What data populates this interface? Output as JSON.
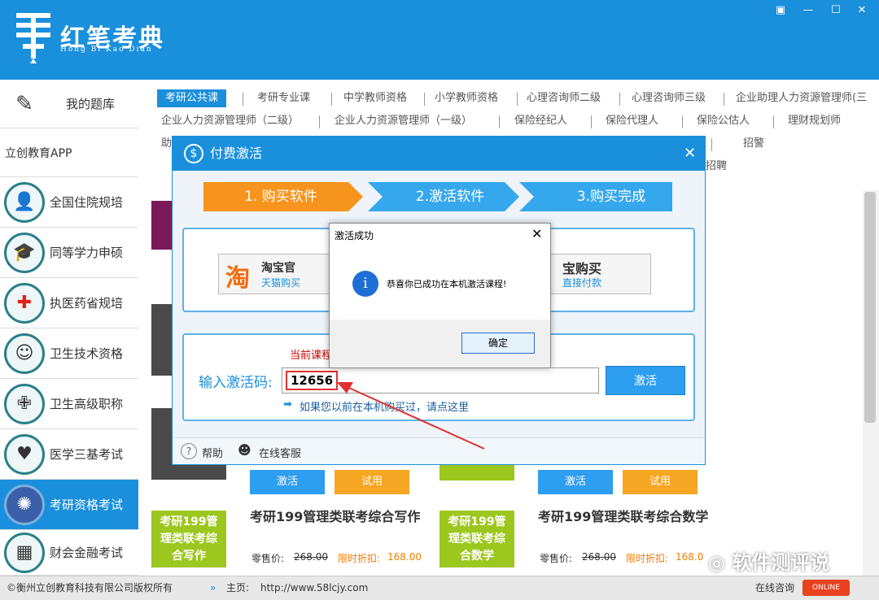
{
  "app": {
    "name_cn": "红笔考典",
    "name_en": "Hong Bi Kao Dian"
  },
  "window_controls": [
    "▣",
    "—",
    "☐",
    "✕"
  ],
  "sidebar": {
    "items": [
      {
        "label": "我的题库",
        "icon": "pen-book-icon"
      },
      {
        "label": "立创教育APP",
        "icon": ""
      },
      {
        "label": "全国住院规培",
        "icon": "doctor-icon"
      },
      {
        "label": "同等学力申硕",
        "icon": "graduation-cap-icon"
      },
      {
        "label": "执医药省规培",
        "icon": "red-cross-icon"
      },
      {
        "label": "卫生技术资格",
        "icon": "nurse-icon"
      },
      {
        "label": "卫生高级职称",
        "icon": "medical-kit-icon"
      },
      {
        "label": "医学三基考试",
        "icon": "medical-bag-icon"
      },
      {
        "label": "考研资格考试",
        "icon": "network-icon"
      },
      {
        "label": "财会金融考试",
        "icon": "calculator-icon"
      }
    ]
  },
  "tabs": {
    "row1": [
      "考研公共课",
      "考研专业课",
      "中学教师资格",
      "小学教师资格",
      "心理咨询师二级",
      "心理咨询师三级",
      "企业助理人力资源管理师(三"
    ],
    "row2": [
      "企业人力资源管理师（二级）",
      "企业人力资源管理师（一级）",
      "保险经纪人",
      "保险代理人",
      "保险公估人",
      "理财规划师"
    ],
    "row3": [
      "助",
      "招警",
      "招聘"
    ]
  },
  "products": [
    {
      "title": "考研199管理类联考综合写作",
      "badge": "考研199管\n理类联考综\n合写作",
      "activate": "激活",
      "trial": "试用",
      "retail_label": "零售价:",
      "retail": "268.00",
      "sale_label": "限时折扣:",
      "sale": "168.00"
    },
    {
      "title": "考研199管理类联考综合数学",
      "badge": "考研199管\n理类联考综\n合数学",
      "activate": "激活",
      "trial": "试用",
      "retail_label": "零售价:",
      "retail": "268.00",
      "sale_label": "限时折扣:",
      "sale": "168.0"
    }
  ],
  "footer": {
    "copyright": "©衡州立创教育科技有限公司版权所有",
    "home_label": "主页:",
    "home_url": "http://www.58lcjy.com",
    "consult": "在线咨询",
    "online": "ONLINE"
  },
  "pay_dialog": {
    "title": "付费激活",
    "steps": [
      "1. 购买软件",
      "2.激活软件",
      "3.购买完成"
    ],
    "taobao_title": "淘宝官",
    "taobao_sub": "天猫购买",
    "alipay_title": "宝购买",
    "alipay_sub": "直接付款",
    "current_course": "当前课程",
    "code_label": "输入激活码:",
    "code_value": "12656",
    "activate_btn": "激活",
    "bought_hint": "如果您以前在本机购买过，请点这里",
    "help": "帮助",
    "service": "在线客服"
  },
  "success_dialog": {
    "title": "激活成功",
    "message": "恭喜你已成功在本机激活课程!",
    "ok": "确定"
  },
  "watermark": "软件测评说"
}
